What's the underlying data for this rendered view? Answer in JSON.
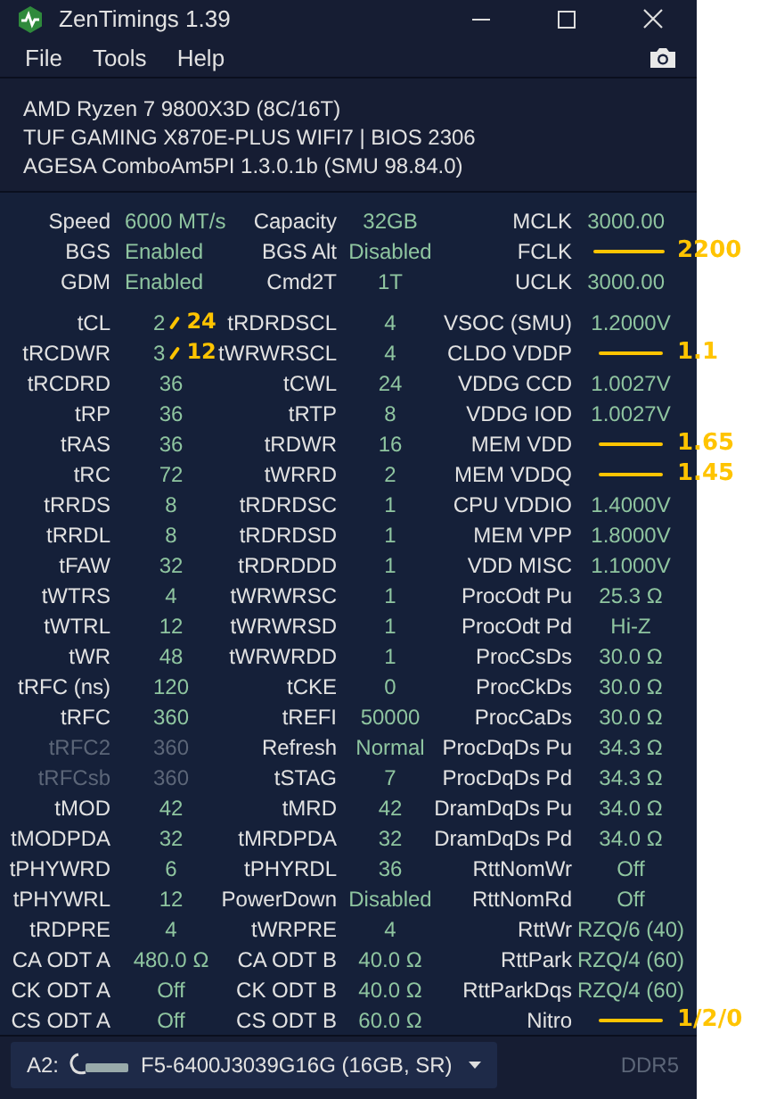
{
  "window": {
    "title": "ZenTimings 1.39"
  },
  "menu": [
    "File",
    "Tools",
    "Help"
  ],
  "system_info": [
    "AMD Ryzen 7 9800X3D (8C/16T)",
    "TUF GAMING X870E-PLUS WIFI7 | BIOS 2306",
    "AGESA ComboAm5PI 1.3.0.1b (SMU 98.84.0)"
  ],
  "summary": [
    [
      {
        "label": "Speed",
        "value": "6000 MT/s",
        "disabled": false
      },
      {
        "label": "Capacity",
        "value": "32GB",
        "disabled": false
      },
      {
        "label": "MCLK",
        "value": "3000.00",
        "disabled": false
      }
    ],
    [
      {
        "label": "BGS",
        "value": "Enabled",
        "disabled": false
      },
      {
        "label": "BGS Alt",
        "value": "Disabled",
        "disabled": false
      },
      {
        "label": "FCLK",
        "disabled": false,
        "correction": "2200"
      }
    ],
    [
      {
        "label": "GDM",
        "value": "Enabled",
        "disabled": false
      },
      {
        "label": "Cmd2T",
        "value": "1T",
        "disabled": false
      },
      {
        "label": "UCLK",
        "value": "3000.00",
        "disabled": false
      }
    ]
  ],
  "timings": [
    [
      {
        "label": "tCL",
        "value": "2",
        "disabled": false,
        "correction": "24"
      },
      {
        "label": "tRDRDSCL",
        "value": "4",
        "disabled": false
      },
      {
        "label": "VSOC (SMU)",
        "value": "1.2000V",
        "disabled": false
      }
    ],
    [
      {
        "label": "tRCDWR",
        "value": "3",
        "disabled": false,
        "correction": "12"
      },
      {
        "label": "tWRWRSCL",
        "value": "4",
        "disabled": false
      },
      {
        "label": "CLDO VDDP",
        "disabled": false,
        "correction": "1.1"
      }
    ],
    [
      {
        "label": "tRCDRD",
        "value": "36",
        "disabled": false
      },
      {
        "label": "tCWL",
        "value": "24",
        "disabled": false
      },
      {
        "label": "VDDG CCD",
        "value": "1.0027V",
        "disabled": false
      }
    ],
    [
      {
        "label": "tRP",
        "value": "36",
        "disabled": false
      },
      {
        "label": "tRTP",
        "value": "8",
        "disabled": false
      },
      {
        "label": "VDDG IOD",
        "value": "1.0027V",
        "disabled": false
      }
    ],
    [
      {
        "label": "tRAS",
        "value": "36",
        "disabled": false
      },
      {
        "label": "tRDWR",
        "value": "16",
        "disabled": false
      },
      {
        "label": "MEM VDD",
        "disabled": false,
        "correction": "1.65"
      }
    ],
    [
      {
        "label": "tRC",
        "value": "72",
        "disabled": false
      },
      {
        "label": "tWRRD",
        "value": "2",
        "disabled": false
      },
      {
        "label": "MEM VDDQ",
        "disabled": false,
        "correction": "1.45"
      }
    ],
    [
      {
        "label": "tRRDS",
        "value": "8",
        "disabled": false
      },
      {
        "label": "tRDRDSC",
        "value": "1",
        "disabled": false
      },
      {
        "label": "CPU VDDIO",
        "value": "1.4000V",
        "disabled": false
      }
    ],
    [
      {
        "label": "tRRDL",
        "value": "8",
        "disabled": false
      },
      {
        "label": "tRDRDSD",
        "value": "1",
        "disabled": false
      },
      {
        "label": "MEM VPP",
        "value": "1.8000V",
        "disabled": false
      }
    ],
    [
      {
        "label": "tFAW",
        "value": "32",
        "disabled": false
      },
      {
        "label": "tRDRDDD",
        "value": "1",
        "disabled": false
      },
      {
        "label": "VDD MISC",
        "value": "1.1000V",
        "disabled": false
      }
    ],
    [
      {
        "label": "tWTRS",
        "value": "4",
        "disabled": false
      },
      {
        "label": "tWRWRSC",
        "value": "1",
        "disabled": false
      },
      {
        "label": "ProcOdt Pu",
        "value": "25.3 Ω",
        "disabled": false
      }
    ],
    [
      {
        "label": "tWTRL",
        "value": "12",
        "disabled": false
      },
      {
        "label": "tWRWRSD",
        "value": "1",
        "disabled": false
      },
      {
        "label": "ProcOdt Pd",
        "value": "Hi-Z",
        "disabled": false
      }
    ],
    [
      {
        "label": "tWR",
        "value": "48",
        "disabled": false
      },
      {
        "label": "tWRWRDD",
        "value": "1",
        "disabled": false
      },
      {
        "label": "ProcCsDs",
        "value": "30.0 Ω",
        "disabled": false
      }
    ],
    [
      {
        "label": "tRFC (ns)",
        "value": "120",
        "disabled": false
      },
      {
        "label": "tCKE",
        "value": "0",
        "disabled": false
      },
      {
        "label": "ProcCkDs",
        "value": "30.0 Ω",
        "disabled": false
      }
    ],
    [
      {
        "label": "tRFC",
        "value": "360",
        "disabled": false
      },
      {
        "label": "tREFI",
        "value": "50000",
        "disabled": false
      },
      {
        "label": "ProcCaDs",
        "value": "30.0 Ω",
        "disabled": false
      }
    ],
    [
      {
        "label": "tRFC2",
        "value": "360",
        "disabled": true
      },
      {
        "label": "Refresh",
        "value": "Normal",
        "disabled": false
      },
      {
        "label": "ProcDqDs Pu",
        "value": "34.3 Ω",
        "disabled": false
      }
    ],
    [
      {
        "label": "tRFCsb",
        "value": "360",
        "disabled": true
      },
      {
        "label": "tSTAG",
        "value": "7",
        "disabled": false
      },
      {
        "label": "ProcDqDs Pd",
        "value": "34.3 Ω",
        "disabled": false
      }
    ],
    [
      {
        "label": "tMOD",
        "value": "42",
        "disabled": false
      },
      {
        "label": "tMRD",
        "value": "42",
        "disabled": false
      },
      {
        "label": "DramDqDs Pu",
        "value": "34.0 Ω",
        "disabled": false
      }
    ],
    [
      {
        "label": "tMODPDA",
        "value": "32",
        "disabled": false
      },
      {
        "label": "tMRDPDA",
        "value": "32",
        "disabled": false
      },
      {
        "label": "DramDqDs Pd",
        "value": "34.0 Ω",
        "disabled": false
      }
    ],
    [
      {
        "label": "tPHYWRD",
        "value": "6",
        "disabled": false
      },
      {
        "label": "tPHYRDL",
        "value": "36",
        "disabled": false
      },
      {
        "label": "RttNomWr",
        "value": "Off",
        "disabled": false
      }
    ],
    [
      {
        "label": "tPHYWRL",
        "value": "12",
        "disabled": false
      },
      {
        "label": "PowerDown",
        "value": "Disabled",
        "disabled": false
      },
      {
        "label": "RttNomRd",
        "value": "Off",
        "disabled": false
      }
    ],
    [
      {
        "label": "tRDPRE",
        "value": "4",
        "disabled": false
      },
      {
        "label": "tWRPRE",
        "value": "4",
        "disabled": false
      },
      {
        "label": "RttWr",
        "value": "RZQ/6 (40)",
        "disabled": false
      }
    ],
    [
      {
        "label": "CA ODT A",
        "value": "480.0 Ω",
        "disabled": false
      },
      {
        "label": "CA ODT B",
        "value": "40.0 Ω",
        "disabled": false
      },
      {
        "label": "RttPark",
        "value": "RZQ/4 (60)",
        "disabled": false
      }
    ],
    [
      {
        "label": "CK ODT A",
        "value": "Off",
        "disabled": false
      },
      {
        "label": "CK ODT B",
        "value": "40.0 Ω",
        "disabled": false
      },
      {
        "label": "RttParkDqs",
        "value": "RZQ/4 (60)",
        "disabled": false
      }
    ],
    [
      {
        "label": "CS ODT A",
        "value": "Off",
        "disabled": false
      },
      {
        "label": "CS ODT B",
        "value": "60.0 Ω",
        "disabled": false
      },
      {
        "label": "Nitro",
        "disabled": false,
        "correction": "1/2/0"
      }
    ]
  ],
  "module_select": {
    "slot": "A2:",
    "value": "F5-6400J3039G16G (16GB, SR)"
  },
  "memory_type": "DDR5"
}
